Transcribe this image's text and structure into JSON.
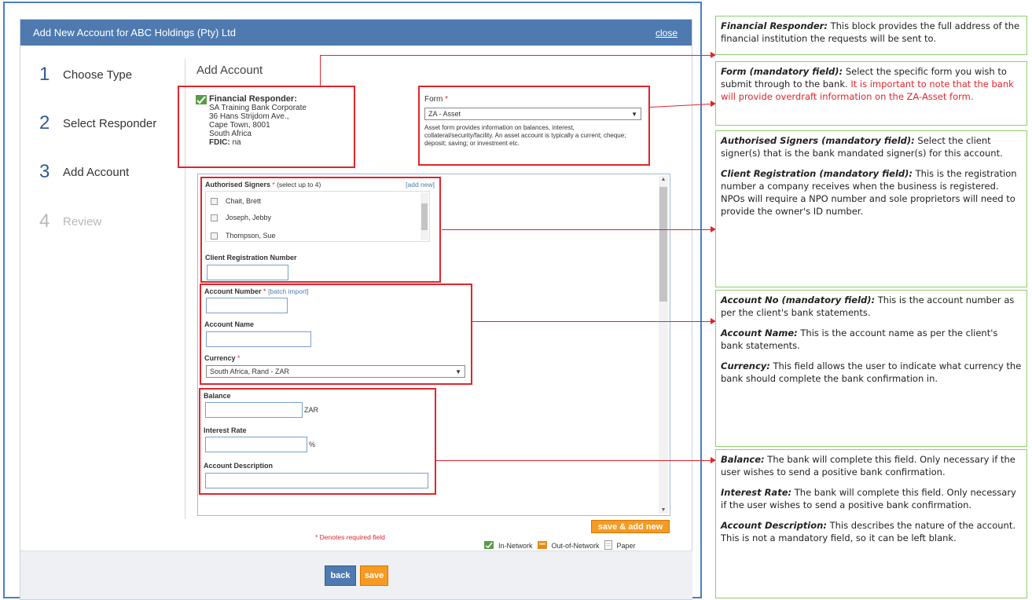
{
  "modal": {
    "title": "Add New Account for ABC Holdings (Pty) Ltd",
    "close": "close"
  },
  "steps": [
    {
      "num": "1",
      "label": "Choose Type"
    },
    {
      "num": "2",
      "label": "Select Responder"
    },
    {
      "num": "3",
      "label": "Add Account"
    },
    {
      "num": "4",
      "label": "Review"
    }
  ],
  "main": {
    "heading": "Add Account",
    "responder": {
      "label": "Financial Responder:",
      "lines": [
        "SA Training Bank Corporate",
        "36 Hans Strijdom Ave.,",
        "Cape Town, 8001",
        "South Africa"
      ],
      "fdic_label": "FDIC:",
      "fdic_value": "na"
    },
    "form": {
      "label": "Form",
      "required_mark": "*",
      "selected": "ZA - Asset",
      "description": "Asset form provides information on balances, interest, collateral/security/facility. An asset account is typically a current; cheque; deposit; saving; or investment etc."
    },
    "signers": {
      "label": "Authorised Signers",
      "required_mark": "*",
      "hint": "(select up to 4)",
      "add_new": "[add new]",
      "items": [
        "Chait, Brett",
        "Joseph, Jebby",
        "Thompson, Sue"
      ]
    },
    "client_reg": {
      "label": "Client Registration Number",
      "value": ""
    },
    "account_number": {
      "label": "Account Number",
      "required_mark": "*",
      "batch_import": "[batch import]",
      "value": ""
    },
    "account_name": {
      "label": "Account Name",
      "value": ""
    },
    "currency": {
      "label": "Currency",
      "required_mark": "*",
      "selected": "South Africa, Rand - ZAR"
    },
    "balance": {
      "label": "Balance",
      "unit": "ZAR",
      "value": ""
    },
    "interest_rate": {
      "label": "Interest Rate",
      "unit": "%",
      "value": ""
    },
    "account_description": {
      "label": "Account Description",
      "value": ""
    },
    "required_note": "* Denotes required field",
    "save_add_new": "save & add new",
    "legend": {
      "in_network": "In-Network",
      "out_of_network": "Out-of-Network",
      "paper": "Paper"
    },
    "back": "back",
    "save": "save"
  },
  "annotations": {
    "responder": {
      "term": "Financial Responder:",
      "text": "This block provides the full address of the financial institution the requests will be sent to."
    },
    "form": {
      "term": "Form (mandatory field):",
      "text": "Select the specific form you wish to submit through to the bank.",
      "red": "It is important to note that the bank will provide overdraft information on the ZA-Asset form."
    },
    "signers": {
      "term": "Authorised Signers (mandatory field):",
      "text": "Select the client signer(s) that is the bank mandated signer(s) for this account."
    },
    "client_reg": {
      "term": "Client Registration (mandatory field):",
      "text": "This is the registration number a company receives when the business is registered. NPOs will require a NPO number and sole proprietors will need to provide the owner's ID number."
    },
    "account_no": {
      "term": "Account No (mandatory field):",
      "text": "This is the account number as per the client's bank statements."
    },
    "account_name": {
      "term": "Account Name:",
      "text": "This is the account name as per the client's bank statements."
    },
    "currency": {
      "term": "Currency:",
      "text": "This field allows the user to indicate what currency the bank should complete the bank confirmation in."
    },
    "balance": {
      "term": "Balance:",
      "text": "The bank will complete this field. Only necessary if the user wishes to send a positive bank confirmation."
    },
    "interest": {
      "term": "Interest Rate:",
      "text": "The bank will complete this field. Only necessary if the user wishes to send a positive bank confirmation."
    },
    "description": {
      "term": "Account Description:",
      "text": "This describes the nature of the account. This is not a mandatory field, so it can be left blank."
    }
  },
  "colors": {
    "header": "#4e7ab0",
    "highlight": "#e0252c",
    "annotation_border": "#8ccf6e",
    "button_orange": "#f59a23"
  }
}
